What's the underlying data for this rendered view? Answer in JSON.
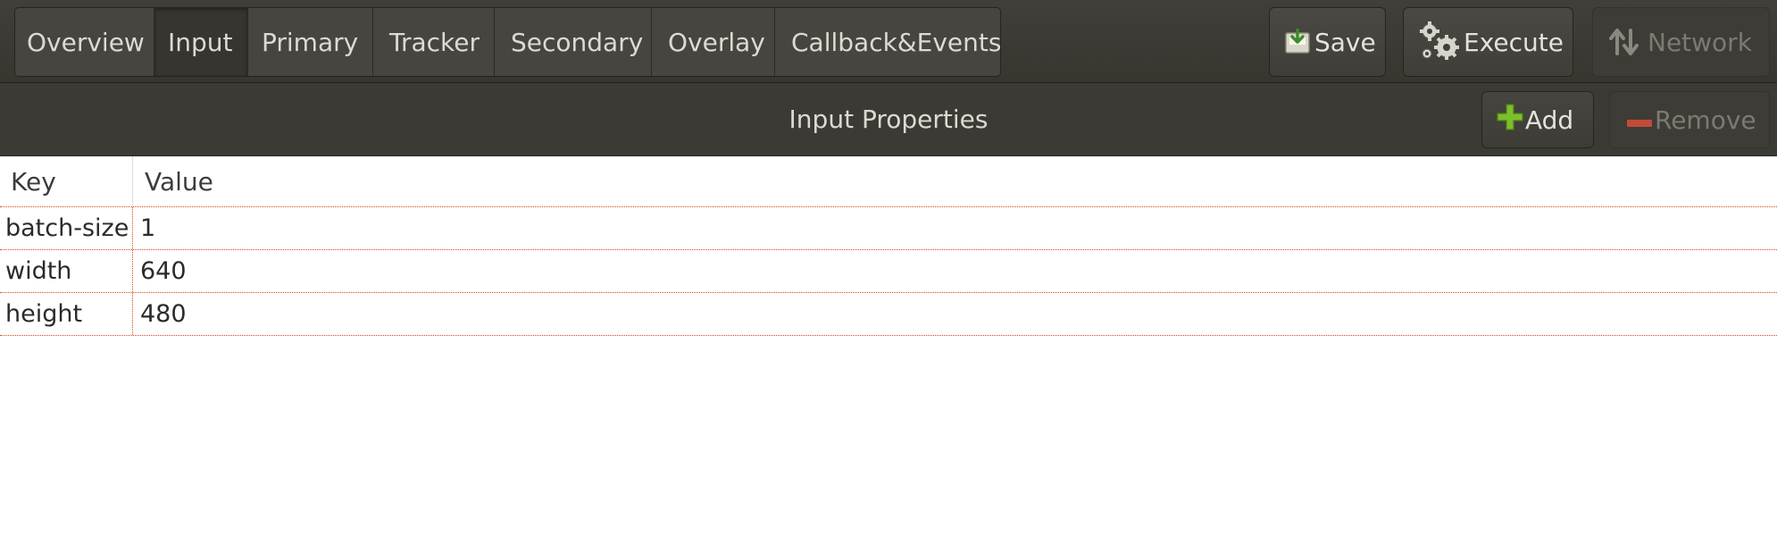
{
  "tabs": [
    {
      "label": "Overview",
      "active": false
    },
    {
      "label": "Input",
      "active": true
    },
    {
      "label": "Primary",
      "active": false
    },
    {
      "label": "Tracker",
      "active": false
    },
    {
      "label": "Secondary",
      "active": false
    },
    {
      "label": "Overlay",
      "active": false
    },
    {
      "label": "Callback&Events",
      "active": false
    }
  ],
  "toolbar": {
    "save_label": "Save",
    "save_icon": "save-download-icon",
    "execute_label": "Execute",
    "execute_icon": "gears-icon",
    "network_label": "Network",
    "network_icon": "up-down-arrows-icon",
    "network_disabled": true
  },
  "properties": {
    "title": "Input Properties",
    "add_label": "Add",
    "add_icon": "green-plus-icon",
    "remove_label": "Remove",
    "remove_icon": "red-minus-icon",
    "remove_disabled": true
  },
  "table": {
    "headers": {
      "key": "Key",
      "value": "Value"
    },
    "rows": [
      {
        "key": "batch-size",
        "value": "1"
      },
      {
        "key": "width",
        "value": "640"
      },
      {
        "key": "height",
        "value": "480"
      }
    ]
  },
  "colors": {
    "toolbar_bg": "#403f3a",
    "header_bg": "#3b3a34",
    "row_divider": "#d9480f",
    "add_icon": "#7dbe2e",
    "remove_icon": "#c44a3a"
  }
}
